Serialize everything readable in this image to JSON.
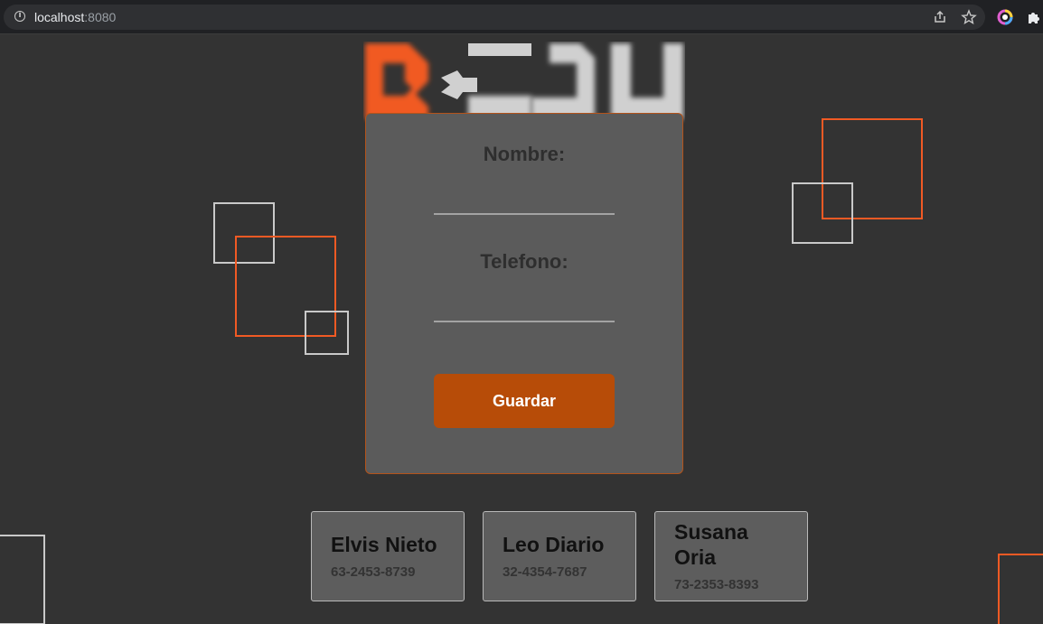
{
  "browser": {
    "url_host": "localhost",
    "url_port": ":8080",
    "icons": [
      "info-icon",
      "share-icon",
      "star-icon",
      "extension-color-icon",
      "puzzle-icon"
    ]
  },
  "logo": {
    "text": "BEDU",
    "colors": {
      "accent": "#f15a24",
      "light": "#d0d0d0"
    }
  },
  "form": {
    "name_label": "Nombre:",
    "name_value": "",
    "phone_label": "Telefono:",
    "phone_value": "",
    "save_label": "Guardar"
  },
  "contacts": [
    {
      "name": "Elvis Nieto",
      "phone": "63-2453-8739"
    },
    {
      "name": "Leo Diario",
      "phone": "32-4354-7687"
    },
    {
      "name": "Susana Oria",
      "phone": "73-2353-8393"
    }
  ],
  "colors": {
    "background": "#333333",
    "panel": "#5b5b5b",
    "button": "#b74c08",
    "accent": "#f15a24",
    "square_light": "#c9c9c9"
  }
}
